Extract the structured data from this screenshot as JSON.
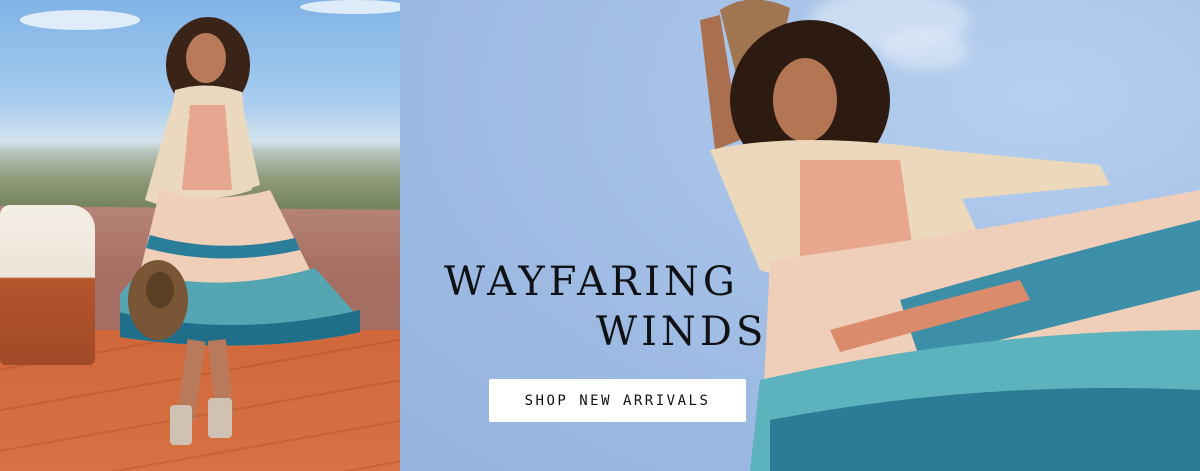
{
  "banner": {
    "headline_line1": "WAYFARING",
    "headline_line2": "WINDS",
    "cta_label": "SHOP NEW ARRIVALS"
  },
  "images": {
    "left": "model-in-floral-tiered-dress-on-terrace",
    "right": "model-twirling-floral-dress-against-sky"
  },
  "colors": {
    "sky": "#9fbde4",
    "headline": "#0f1115",
    "cta_background": "#ffffff",
    "cta_text": "#111111"
  }
}
